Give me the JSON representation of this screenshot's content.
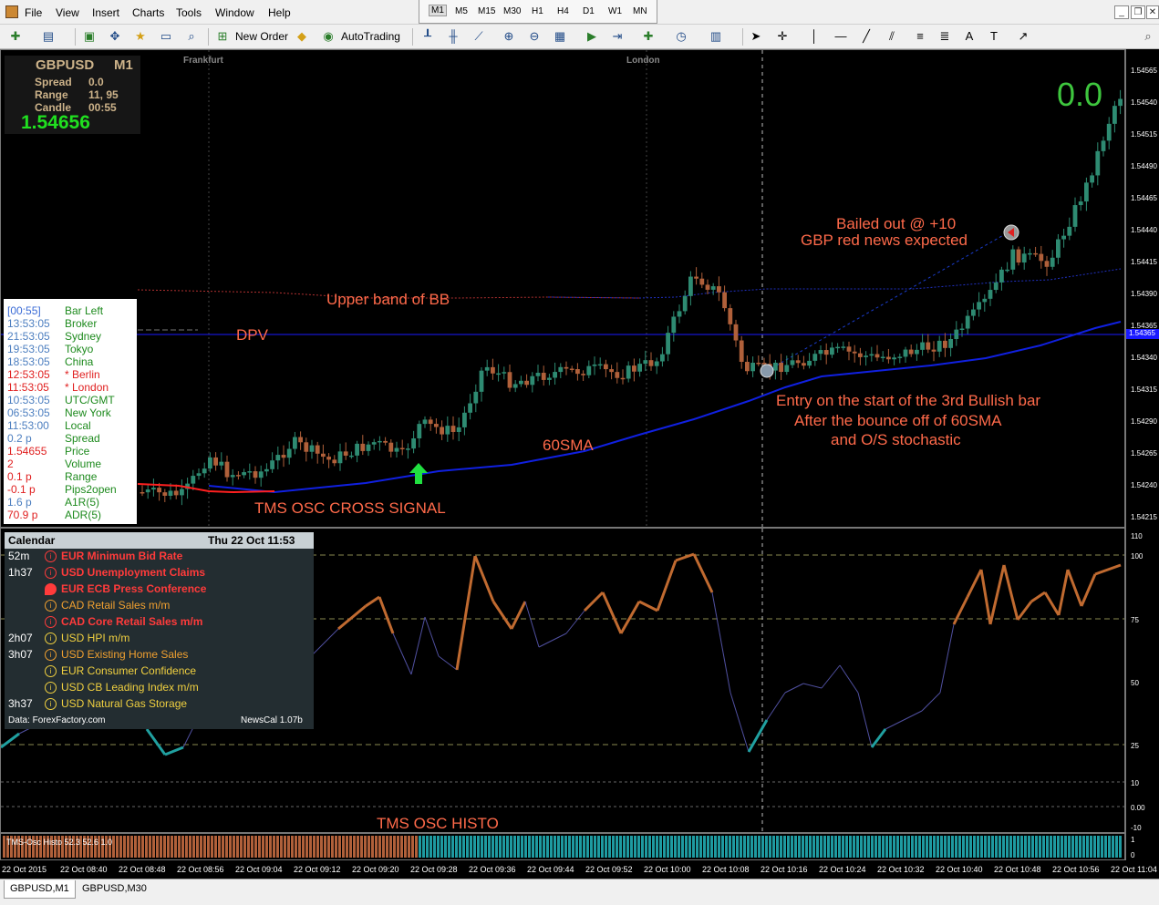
{
  "menu": [
    "File",
    "View",
    "Insert",
    "Charts",
    "Tools",
    "Window",
    "Help"
  ],
  "timeframes": [
    "M1",
    "M5",
    "M15",
    "M30",
    "H1",
    "H4",
    "D1",
    "W1",
    "MN"
  ],
  "toolbar": {
    "new_order": "New Order",
    "autotrading": "AutoTrading"
  },
  "sessions": [
    "Frankfurt",
    "London"
  ],
  "info": {
    "symbol": "GBPUSD",
    "period": "M1",
    "spread_label": "Spread",
    "spread_value": "0.0",
    "range_label": "Range",
    "range_value": "11, 95",
    "candle_label": "Candle",
    "candle_value": "00:55",
    "price": "1.54656"
  },
  "big_counter": "0.0",
  "clock_rows": [
    {
      "value": "[00:55]",
      "label": "Bar Left",
      "vc": "#3a6bd6",
      "lc": "#1d8a1d"
    },
    {
      "value": "13:53:05",
      "label": "Broker",
      "vc": "#4d7fc0",
      "lc": "#1d8a1d"
    },
    {
      "value": "21:53:05",
      "label": "Sydney",
      "vc": "#4d7fc0",
      "lc": "#1d8a1d"
    },
    {
      "value": "19:53:05",
      "label": "Tokyo",
      "vc": "#4d7fc0",
      "lc": "#1d8a1d"
    },
    {
      "value": "18:53:05",
      "label": "China",
      "vc": "#4d7fc0",
      "lc": "#1d8a1d"
    },
    {
      "value": "12:53:05",
      "label": "* Berlin",
      "vc": "#e02020",
      "lc": "#e02020"
    },
    {
      "value": "11:53:05",
      "label": "* London",
      "vc": "#e02020",
      "lc": "#e02020"
    },
    {
      "value": "10:53:05",
      "label": "UTC/GMT",
      "vc": "#4d7fc0",
      "lc": "#1d8a1d"
    },
    {
      "value": "06:53:05",
      "label": "New York",
      "vc": "#4d7fc0",
      "lc": "#1d8a1d"
    },
    {
      "value": "11:53:00",
      "label": "Local",
      "vc": "#4d7fc0",
      "lc": "#1d8a1d"
    },
    {
      "value": "0.2 p",
      "label": "Spread",
      "vc": "#4d7fc0",
      "lc": "#1d8a1d"
    },
    {
      "value": "1.54655",
      "label": "Price",
      "vc": "#e02020",
      "lc": "#1d8a1d"
    },
    {
      "value": "2",
      "label": "Volume",
      "vc": "#e02020",
      "lc": "#1d8a1d"
    },
    {
      "value": "0.1 p",
      "label": "Range",
      "vc": "#e02020",
      "lc": "#1d8a1d"
    },
    {
      "value": "-0.1 p",
      "label": "Pips2open",
      "vc": "#e02020",
      "lc": "#1d8a1d"
    },
    {
      "value": "1.6 p",
      "label": "A1R(5)",
      "vc": "#4d7fc0",
      "lc": "#1d8a1d"
    },
    {
      "value": "70.9 p",
      "label": "ADR(5)",
      "vc": "#e02020",
      "lc": "#1d8a1d"
    }
  ],
  "calendar": {
    "title": "Calendar",
    "date": "Thu 22 Oct 11:53",
    "footer_left": "Data: ForexFactory.com",
    "footer_right": "NewsCal 1.07b",
    "events": [
      {
        "time": "52m",
        "currency": "EUR",
        "title": "Minimum Bid Rate",
        "color": "#ff3b3b",
        "bold": true,
        "icon": "i"
      },
      {
        "time": "1h37",
        "currency": "USD",
        "title": "Unemployment Claims",
        "color": "#ff3b3b",
        "bold": true,
        "icon": "i"
      },
      {
        "time": "",
        "currency": "EUR",
        "title": "ECB Press Conference",
        "color": "#ff3b3b",
        "bold": true,
        "icon": "speech"
      },
      {
        "time": "",
        "currency": "CAD",
        "title": "Retail Sales m/m",
        "color": "#f0a030",
        "bold": false,
        "icon": "i"
      },
      {
        "time": "",
        "currency": "CAD",
        "title": "Core Retail Sales m/m",
        "color": "#ff3b3b",
        "bold": true,
        "icon": "i"
      },
      {
        "time": "2h07",
        "currency": "USD",
        "title": "HPI m/m",
        "color": "#f0d040",
        "bold": false,
        "icon": "i"
      },
      {
        "time": "3h07",
        "currency": "USD",
        "title": "Existing Home Sales",
        "color": "#f0a030",
        "bold": false,
        "icon": "i"
      },
      {
        "time": "",
        "currency": "EUR",
        "title": "Consumer Confidence",
        "color": "#f0d040",
        "bold": false,
        "icon": "i"
      },
      {
        "time": "",
        "currency": "USD",
        "title": "CB Leading Index m/m",
        "color": "#f0d040",
        "bold": false,
        "icon": "i"
      },
      {
        "time": "3h37",
        "currency": "USD",
        "title": "Natural Gas Storage",
        "color": "#f0d040",
        "bold": false,
        "icon": "i"
      }
    ]
  },
  "annotations": {
    "upper_band": "Upper band of BB",
    "dpv": "DPV",
    "sma": "60SMA",
    "cross": "TMS OSC CROSS SIGNAL",
    "bailed_1": "Bailed out @ +10",
    "bailed_2": "GBP red news expected",
    "entry_1": "Entry on the start of the 3rd Bullish bar",
    "entry_2": "After the bounce off of 60SMA",
    "entry_3": "and O/S stochastic",
    "histo": "TMS OSC HISTO"
  },
  "price_axis": [
    "1.54565",
    "1.54540",
    "1.54515",
    "1.54490",
    "1.54465",
    "1.54440",
    "1.54415",
    "1.54390",
    "1.54365",
    "1.54340",
    "1.54315",
    "1.54290",
    "1.54265",
    "1.54240",
    "1.54215"
  ],
  "current_price_tag": "1.54365",
  "osc_axis": [
    "110",
    "100",
    "75",
    "50",
    "25",
    "10",
    "0.00",
    "-10"
  ],
  "histo_axis": [
    "1",
    "0"
  ],
  "histo_label": "TMS-Osc Histo 52.3 52.6 1.0",
  "time_axis": [
    "22 Oct 2015",
    "22 Oct 08:40",
    "22 Oct 08:48",
    "22 Oct 08:56",
    "22 Oct 09:04",
    "22 Oct 09:12",
    "22 Oct 09:20",
    "22 Oct 09:28",
    "22 Oct 09:36",
    "22 Oct 09:44",
    "22 Oct 09:52",
    "22 Oct 10:00",
    "22 Oct 10:08",
    "22 Oct 10:16",
    "22 Oct 10:24",
    "22 Oct 10:32",
    "22 Oct 10:40",
    "22 Oct 10:48",
    "22 Oct 10:56",
    "22 Oct 11:04"
  ],
  "tabs": [
    "GBPUSD,M1",
    "GBPUSD,M30"
  ],
  "colors": {
    "bull": "#2e8b72",
    "bear": "#b0603a",
    "sma": "#1020e0",
    "osc_up": "#c06a30",
    "osc_low": "#20a0a0",
    "osc_mid": "#5050a0"
  }
}
